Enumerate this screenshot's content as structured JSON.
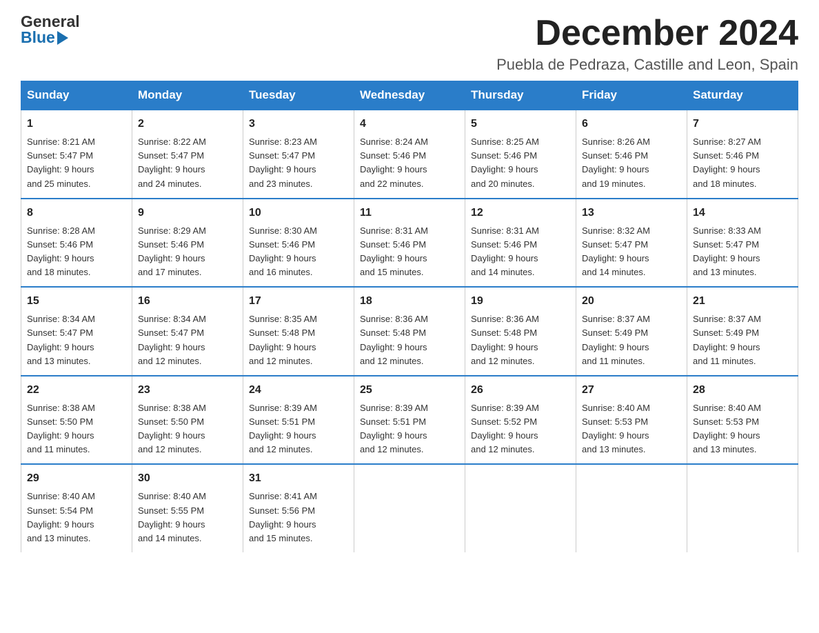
{
  "header": {
    "logo_general": "General",
    "logo_blue": "Blue",
    "title": "December 2024",
    "location": "Puebla de Pedraza, Castille and Leon, Spain"
  },
  "weekdays": [
    "Sunday",
    "Monday",
    "Tuesday",
    "Wednesday",
    "Thursday",
    "Friday",
    "Saturday"
  ],
  "weeks": [
    [
      {
        "day": "1",
        "sunrise": "8:21 AM",
        "sunset": "5:47 PM",
        "daylight": "9 hours and 25 minutes."
      },
      {
        "day": "2",
        "sunrise": "8:22 AM",
        "sunset": "5:47 PM",
        "daylight": "9 hours and 24 minutes."
      },
      {
        "day": "3",
        "sunrise": "8:23 AM",
        "sunset": "5:47 PM",
        "daylight": "9 hours and 23 minutes."
      },
      {
        "day": "4",
        "sunrise": "8:24 AM",
        "sunset": "5:46 PM",
        "daylight": "9 hours and 22 minutes."
      },
      {
        "day": "5",
        "sunrise": "8:25 AM",
        "sunset": "5:46 PM",
        "daylight": "9 hours and 20 minutes."
      },
      {
        "day": "6",
        "sunrise": "8:26 AM",
        "sunset": "5:46 PM",
        "daylight": "9 hours and 19 minutes."
      },
      {
        "day": "7",
        "sunrise": "8:27 AM",
        "sunset": "5:46 PM",
        "daylight": "9 hours and 18 minutes."
      }
    ],
    [
      {
        "day": "8",
        "sunrise": "8:28 AM",
        "sunset": "5:46 PM",
        "daylight": "9 hours and 18 minutes."
      },
      {
        "day": "9",
        "sunrise": "8:29 AM",
        "sunset": "5:46 PM",
        "daylight": "9 hours and 17 minutes."
      },
      {
        "day": "10",
        "sunrise": "8:30 AM",
        "sunset": "5:46 PM",
        "daylight": "9 hours and 16 minutes."
      },
      {
        "day": "11",
        "sunrise": "8:31 AM",
        "sunset": "5:46 PM",
        "daylight": "9 hours and 15 minutes."
      },
      {
        "day": "12",
        "sunrise": "8:31 AM",
        "sunset": "5:46 PM",
        "daylight": "9 hours and 14 minutes."
      },
      {
        "day": "13",
        "sunrise": "8:32 AM",
        "sunset": "5:47 PM",
        "daylight": "9 hours and 14 minutes."
      },
      {
        "day": "14",
        "sunrise": "8:33 AM",
        "sunset": "5:47 PM",
        "daylight": "9 hours and 13 minutes."
      }
    ],
    [
      {
        "day": "15",
        "sunrise": "8:34 AM",
        "sunset": "5:47 PM",
        "daylight": "9 hours and 13 minutes."
      },
      {
        "day": "16",
        "sunrise": "8:34 AM",
        "sunset": "5:47 PM",
        "daylight": "9 hours and 12 minutes."
      },
      {
        "day": "17",
        "sunrise": "8:35 AM",
        "sunset": "5:48 PM",
        "daylight": "9 hours and 12 minutes."
      },
      {
        "day": "18",
        "sunrise": "8:36 AM",
        "sunset": "5:48 PM",
        "daylight": "9 hours and 12 minutes."
      },
      {
        "day": "19",
        "sunrise": "8:36 AM",
        "sunset": "5:48 PM",
        "daylight": "9 hours and 12 minutes."
      },
      {
        "day": "20",
        "sunrise": "8:37 AM",
        "sunset": "5:49 PM",
        "daylight": "9 hours and 11 minutes."
      },
      {
        "day": "21",
        "sunrise": "8:37 AM",
        "sunset": "5:49 PM",
        "daylight": "9 hours and 11 minutes."
      }
    ],
    [
      {
        "day": "22",
        "sunrise": "8:38 AM",
        "sunset": "5:50 PM",
        "daylight": "9 hours and 11 minutes."
      },
      {
        "day": "23",
        "sunrise": "8:38 AM",
        "sunset": "5:50 PM",
        "daylight": "9 hours and 12 minutes."
      },
      {
        "day": "24",
        "sunrise": "8:39 AM",
        "sunset": "5:51 PM",
        "daylight": "9 hours and 12 minutes."
      },
      {
        "day": "25",
        "sunrise": "8:39 AM",
        "sunset": "5:51 PM",
        "daylight": "9 hours and 12 minutes."
      },
      {
        "day": "26",
        "sunrise": "8:39 AM",
        "sunset": "5:52 PM",
        "daylight": "9 hours and 12 minutes."
      },
      {
        "day": "27",
        "sunrise": "8:40 AM",
        "sunset": "5:53 PM",
        "daylight": "9 hours and 13 minutes."
      },
      {
        "day": "28",
        "sunrise": "8:40 AM",
        "sunset": "5:53 PM",
        "daylight": "9 hours and 13 minutes."
      }
    ],
    [
      {
        "day": "29",
        "sunrise": "8:40 AM",
        "sunset": "5:54 PM",
        "daylight": "9 hours and 13 minutes."
      },
      {
        "day": "30",
        "sunrise": "8:40 AM",
        "sunset": "5:55 PM",
        "daylight": "9 hours and 14 minutes."
      },
      {
        "day": "31",
        "sunrise": "8:41 AM",
        "sunset": "5:56 PM",
        "daylight": "9 hours and 15 minutes."
      },
      null,
      null,
      null,
      null
    ]
  ],
  "labels": {
    "sunrise": "Sunrise:",
    "sunset": "Sunset:",
    "daylight": "Daylight:"
  }
}
